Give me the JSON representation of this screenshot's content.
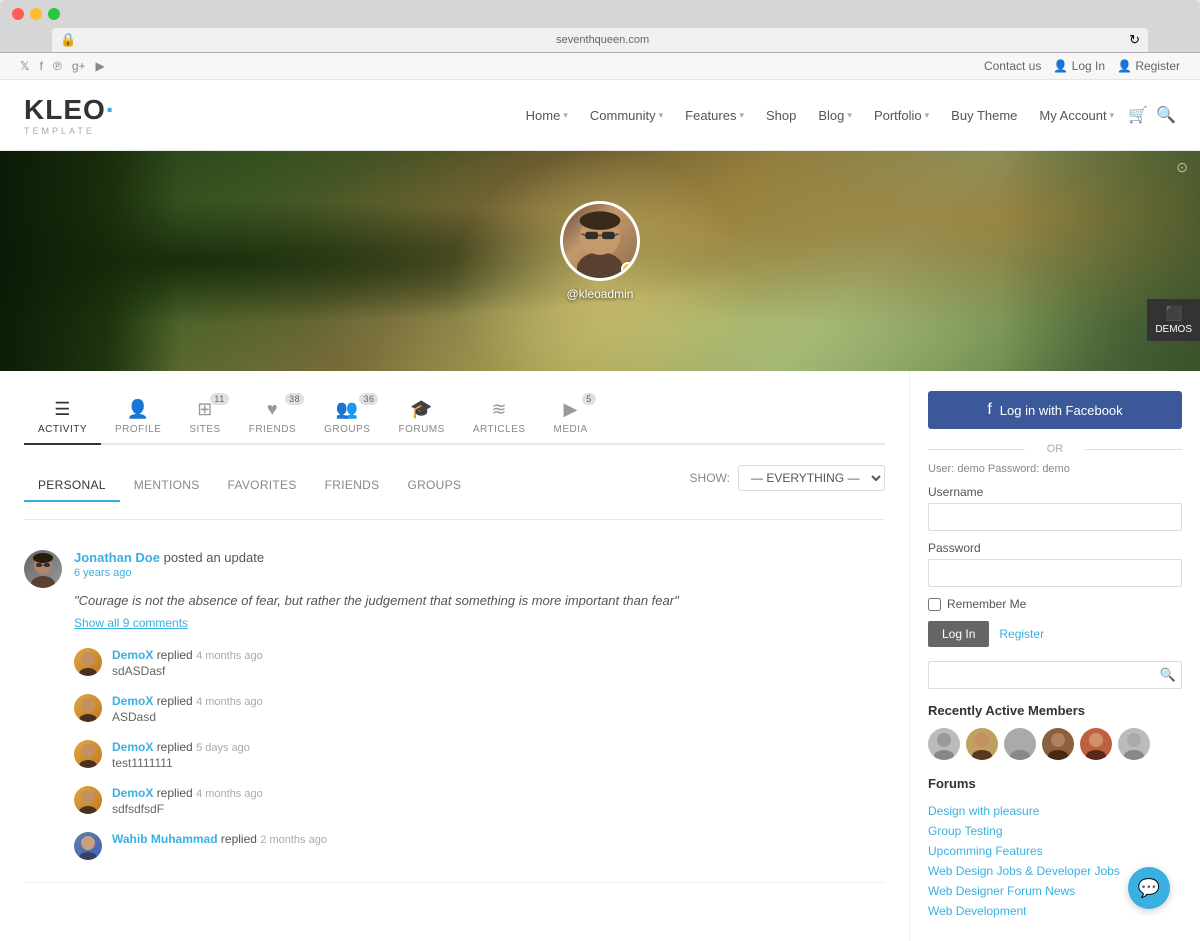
{
  "browser": {
    "url": "seventhqueen.com",
    "add_btn": "+"
  },
  "topbar": {
    "contact": "Contact us",
    "login": "Log In",
    "register": "Register"
  },
  "nav": {
    "home": "Home",
    "community": "Community",
    "features": "Features",
    "shop": "Shop",
    "blog": "Blog",
    "portfolio": "Portfolio",
    "buy_theme": "Buy Theme",
    "my_account": "My Account"
  },
  "logo": {
    "text": "KLEO",
    "accent": "·",
    "sub": "TEMPLATE"
  },
  "profile": {
    "username": "@kleoadmin",
    "display_name": "Jonathan Doe"
  },
  "profile_nav": {
    "tabs": [
      {
        "id": "activity",
        "label": "ACTIVITY",
        "badge": null,
        "active": true
      },
      {
        "id": "profile",
        "label": "PROFILE",
        "badge": null
      },
      {
        "id": "sites",
        "label": "SITES",
        "badge": "11"
      },
      {
        "id": "friends",
        "label": "FRIENDS",
        "badge": "38"
      },
      {
        "id": "groups",
        "label": "GROUPS",
        "badge": "36"
      },
      {
        "id": "forums",
        "label": "FORUMS",
        "badge": null
      },
      {
        "id": "articles",
        "label": "ARTICLES",
        "badge": null
      },
      {
        "id": "media",
        "label": "MEDIA",
        "badge": "5"
      }
    ]
  },
  "activity": {
    "tabs": [
      "PERSONAL",
      "MENTIONS",
      "FAVORITES",
      "FRIENDS",
      "GROUPS"
    ],
    "active_tab": "PERSONAL",
    "show_label": "SHOW:",
    "filter": "— EVERYTHING —",
    "post": {
      "user": "Jonathan Doe",
      "action": "posted an update",
      "time": "6 years ago",
      "text": "\"Courage is not the absence of fear, but rather the judgement that something is more important than fear\"",
      "show_comments": "Show all 9 comments",
      "comments": [
        {
          "user": "DemoX",
          "action": "replied",
          "time": "4 months ago",
          "text": "sdASDasf"
        },
        {
          "user": "DemoX",
          "action": "replied",
          "time": "4 months ago",
          "text": "ASDasd"
        },
        {
          "user": "DemoX",
          "action": "replied",
          "time": "5 days ago",
          "text": "test1111111"
        },
        {
          "user": "DemoX",
          "action": "replied",
          "time": "4 months ago",
          "text": "sdfsdfsdF"
        },
        {
          "user": "Wahib Muhammad",
          "action": "replied",
          "time": "2 months ago",
          "text": ""
        }
      ]
    }
  },
  "sidebar": {
    "fb_login": "Log in with Facebook",
    "or": "OR",
    "demo_hint": "User: demo Password: demo",
    "username_label": "Username",
    "password_label": "Password",
    "remember_label": "Remember Me",
    "login_btn": "Log In",
    "register_link": "Register",
    "recently_active": "Recently Active Members",
    "forums_title": "Forums",
    "forums": [
      "Design with pleasure",
      "Group Testing",
      "Upcomming Features",
      "Web Design Jobs & Developer Jobs",
      "Web Designer Forum News",
      "Web Development"
    ]
  },
  "demos_badge": "DEMOS"
}
